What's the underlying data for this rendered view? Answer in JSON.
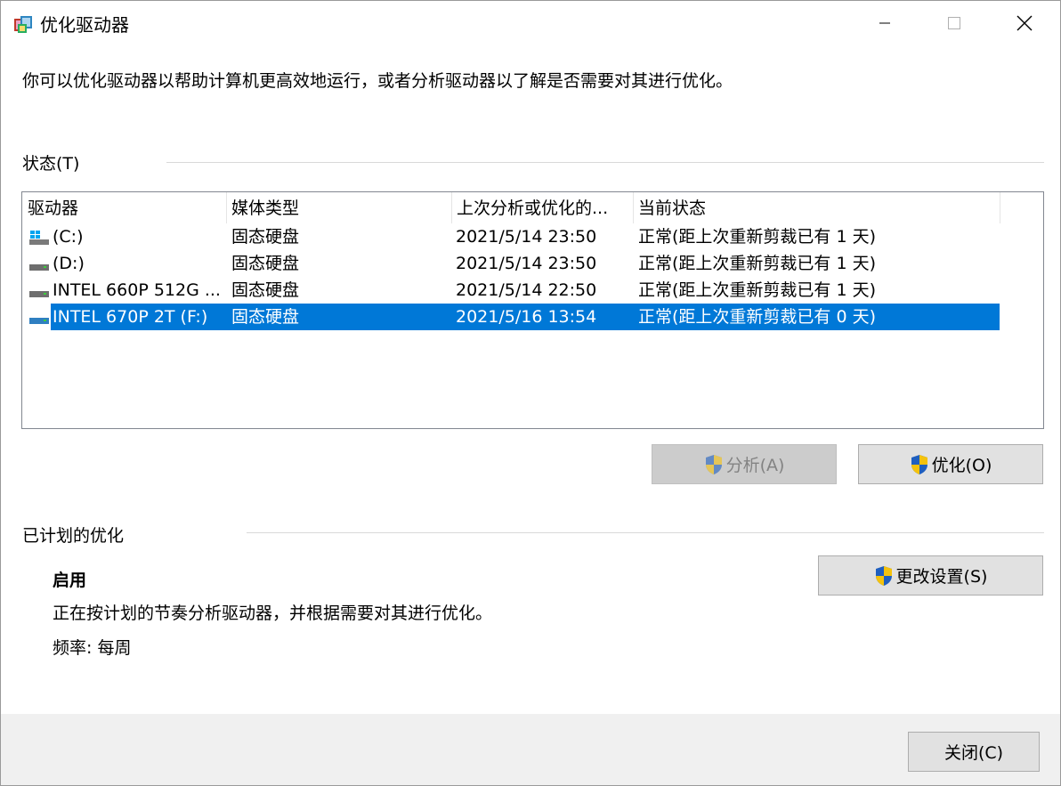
{
  "window": {
    "title": "优化驱动器"
  },
  "description": "你可以优化驱动器以帮助计算机更高效地运行，或者分析驱动器以了解是否需要对其进行优化。",
  "status_section": {
    "label": "状态(T)"
  },
  "list": {
    "columns": [
      "驱动器",
      "媒体类型",
      "上次分析或优化的...",
      "当前状态"
    ],
    "rows": [
      {
        "drive": "(C:)",
        "media": "固态硬盘",
        "last": "2021/5/14 23:50",
        "status": "正常(距上次重新剪裁已有 1 天)",
        "icon": "windows-drive-icon",
        "selected": false
      },
      {
        "drive": "(D:)",
        "media": "固态硬盘",
        "last": "2021/5/14 23:50",
        "status": "正常(距上次重新剪裁已有 1 天)",
        "icon": "drive-icon",
        "selected": false
      },
      {
        "drive": "INTEL 660P 512G ...",
        "media": "固态硬盘",
        "last": "2021/5/14 22:50",
        "status": "正常(距上次重新剪裁已有 1 天)",
        "icon": "drive-icon",
        "selected": false
      },
      {
        "drive": "INTEL 670P 2T (F:)",
        "media": "固态硬盘",
        "last": "2021/5/16 13:54",
        "status": "正常(距上次重新剪裁已有 0 天)",
        "icon": "drive-icon",
        "selected": true
      }
    ]
  },
  "buttons": {
    "analyze": "分析(A)",
    "optimize": "优化(O)",
    "change_settings": "更改设置(S)",
    "close": "关闭(C)"
  },
  "scheduled": {
    "label": "已计划的优化",
    "status": "启用",
    "description": "正在按计划的节奏分析驱动器，并根据需要对其进行优化。",
    "frequency": "频率: 每周"
  },
  "colors": {
    "selection": "#0078d7",
    "button_face": "#e1e1e1",
    "footer": "#f0f0f0"
  }
}
